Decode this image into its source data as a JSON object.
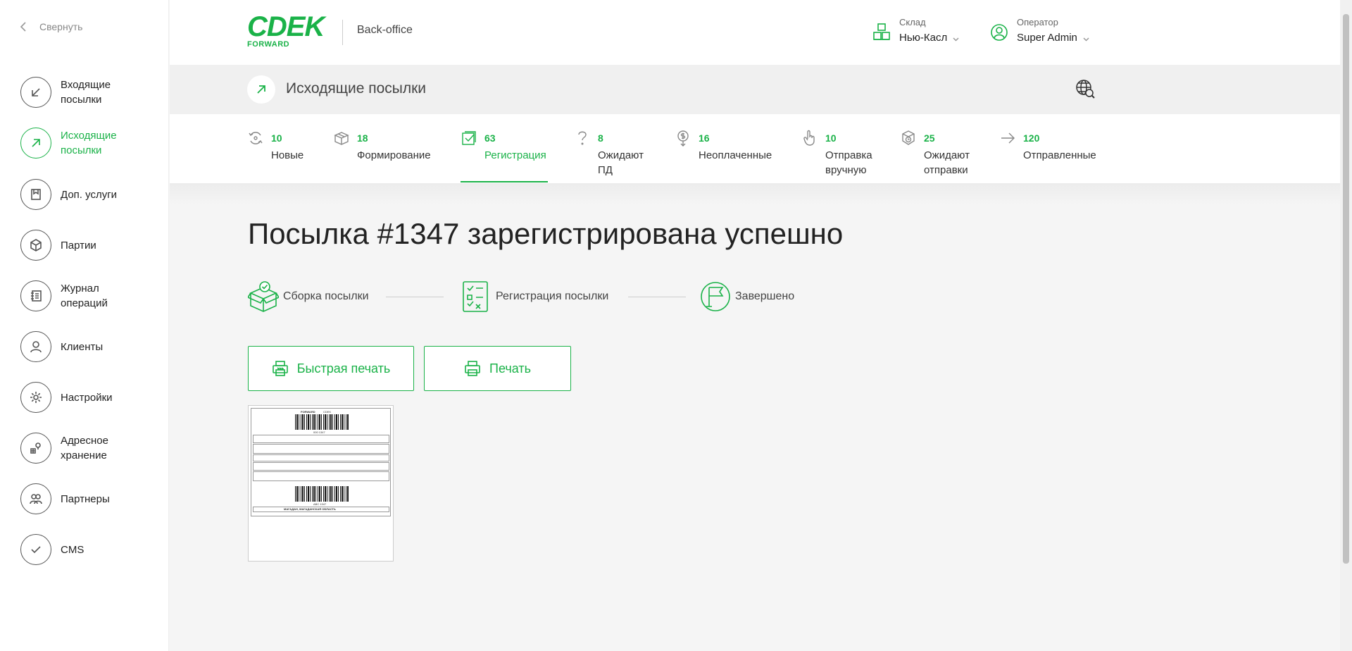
{
  "sidebar": {
    "collapse_label": "Свернуть",
    "items": [
      {
        "label": "Входящие посылки",
        "icon": "arrow-down-left-icon",
        "active": false
      },
      {
        "label": "Исходящие посылки",
        "icon": "arrow-up-right-icon",
        "active": true
      },
      {
        "label": "Доп. услуги",
        "icon": "bookmark-icon",
        "active": false
      },
      {
        "label": "Партии",
        "icon": "box-icon",
        "active": false
      },
      {
        "label": "Журнал операций",
        "icon": "journal-icon",
        "active": false
      },
      {
        "label": "Клиенты",
        "icon": "user-icon",
        "active": false
      },
      {
        "label": "Настройки",
        "icon": "gear-icon",
        "active": false
      },
      {
        "label": "Адресное хранение",
        "icon": "location-storage-icon",
        "active": false
      },
      {
        "label": "Партнеры",
        "icon": "partners-icon",
        "active": false
      },
      {
        "label": "CMS",
        "icon": "check-icon",
        "active": false
      }
    ]
  },
  "header": {
    "logo_text": "CDEK",
    "logo_sub": "FORWARD",
    "app_name": "Back-office",
    "warehouse_label": "Склад",
    "warehouse_value": "Нью-Касл",
    "operator_label": "Оператор",
    "operator_value": "Super Admin"
  },
  "page": {
    "title": "Исходящие посылки"
  },
  "tabs": [
    {
      "count": "10",
      "label": "Новые",
      "icon": "recycle-icon"
    },
    {
      "count": "18",
      "label": "Формирование",
      "icon": "box-open-icon"
    },
    {
      "count": "63",
      "label": "Регистрация",
      "icon": "checkbox-icon",
      "active": true
    },
    {
      "count": "8",
      "label": "Ожидают ПД",
      "icon": "question-icon"
    },
    {
      "count": "16",
      "label": "Неоплаченные",
      "icon": "dollar-icon"
    },
    {
      "count": "10",
      "label": "Отправка вручную",
      "icon": "hand-pointer-icon"
    },
    {
      "count": "25",
      "label": "Ожидают отправки",
      "icon": "box-clock-icon"
    },
    {
      "count": "120",
      "label": "Отправленные",
      "icon": "arrow-right-icon"
    }
  ],
  "main": {
    "heading": "Посылка #1347 зарегистрирована успешно",
    "steps": [
      {
        "label": "Сборка посылки",
        "icon": "box-check-icon"
      },
      {
        "label": "Регистрация посылки",
        "icon": "checklist-icon"
      },
      {
        "label": "Завершено",
        "icon": "flag-icon"
      }
    ],
    "quick_print_label": "Быстрая печать",
    "print_label": "Печать",
    "label_preview": {
      "top_left": "FORWARD",
      "top_right": "CDEK",
      "code_1": "000 1347",
      "code_2": "ABC 1347",
      "city": "МАГАДАН, МАГАДАНСКАЯ ОБЛАСТЬ"
    }
  },
  "colors": {
    "brand": "#1ab248",
    "text": "#222222",
    "muted": "#888888"
  }
}
